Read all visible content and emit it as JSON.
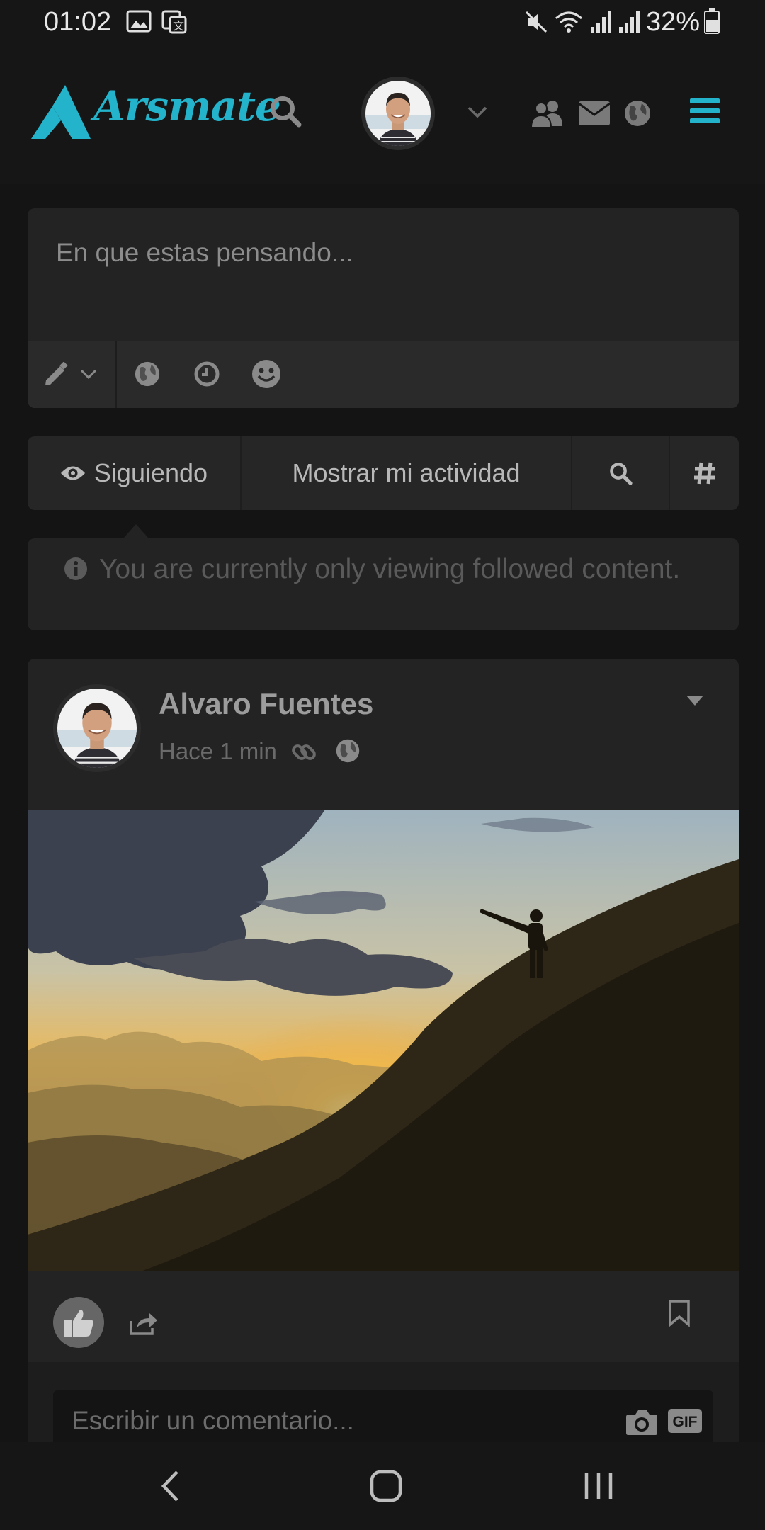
{
  "status_bar": {
    "time": "01:02",
    "battery": "32%"
  },
  "header": {
    "brand": "Arsmate"
  },
  "composer": {
    "placeholder": "En que estas pensando..."
  },
  "filter": {
    "following_label": "Siguiendo",
    "activity_label": "Mostrar mi actividad"
  },
  "notice": {
    "text": "You are currently only viewing followed content."
  },
  "post": {
    "author": "Alvaro Fuentes",
    "time": "Hace 1 min",
    "comment_placeholder": "Escribir un comentario..."
  },
  "colors": {
    "accent": "#23b4cc",
    "background": "#141414",
    "card": "#232323"
  }
}
